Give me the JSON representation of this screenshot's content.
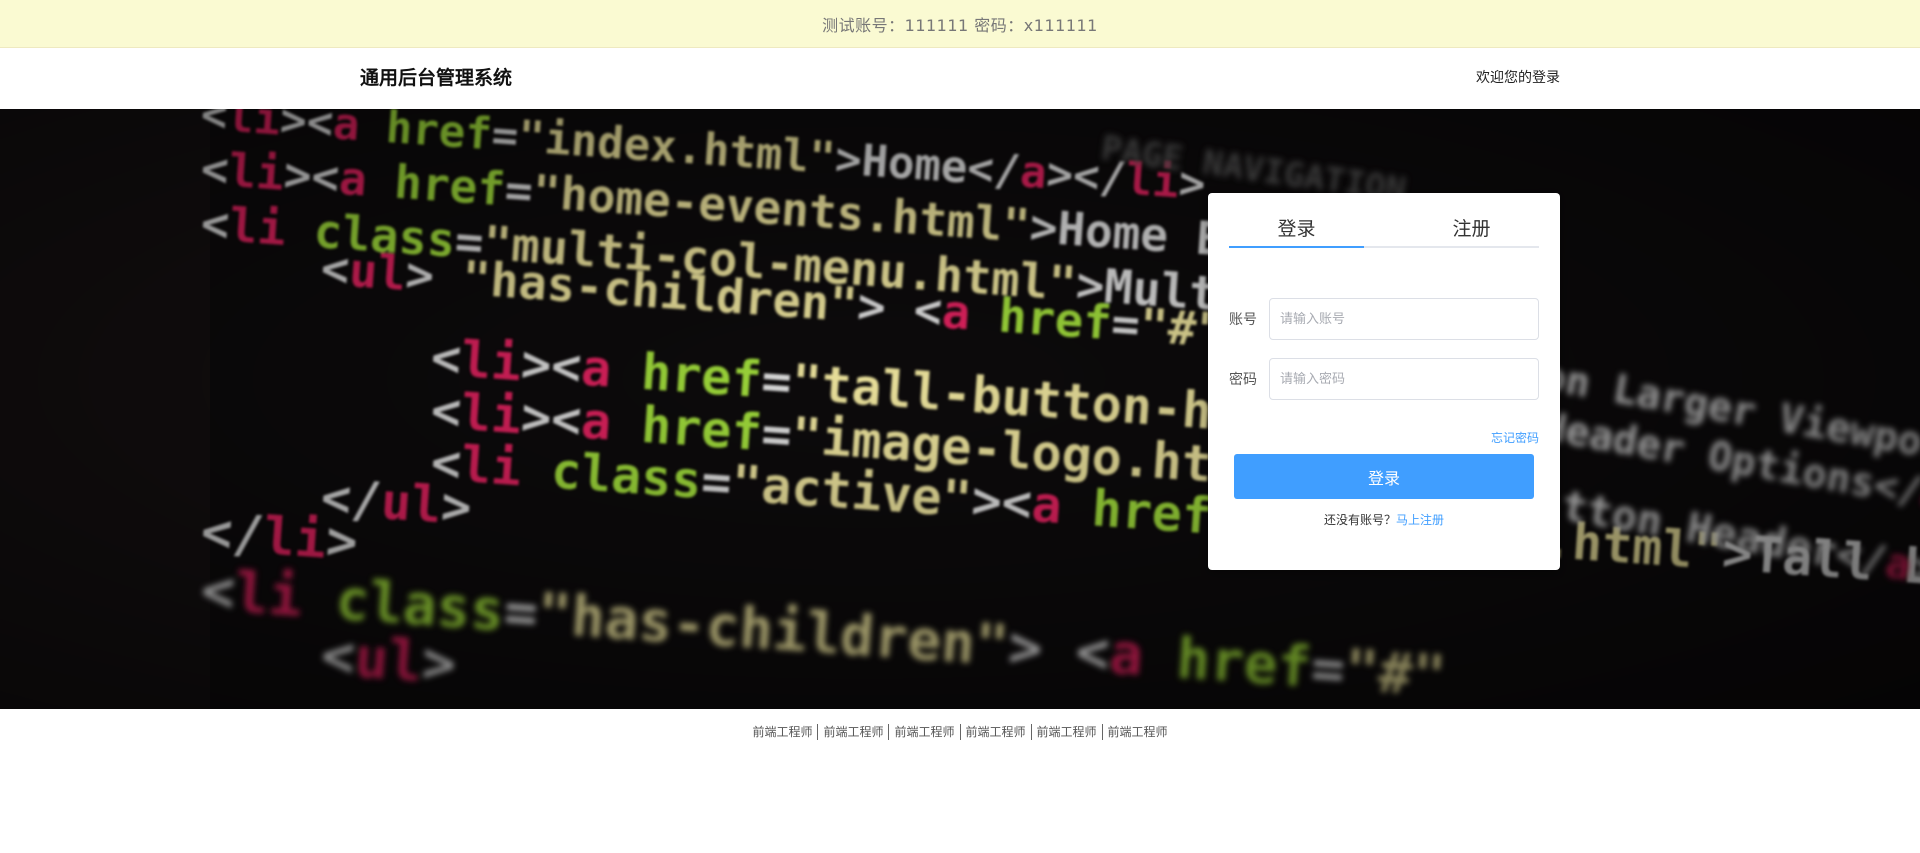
{
  "notice": {
    "text": "测试账号：111111 密码：x111111"
  },
  "header": {
    "title": "通用后台管理系统",
    "welcome": "欢迎您的登录"
  },
  "hero": {
    "code_lines": [
      [
        "<li><a href=\"index.html\">Home</a></li>"
      ],
      [
        "<li><a href=\"home-events.html\">Home Events</a></li>"
      ],
      [
        "<li class=\"has-children\"><a href=\"#\">Multi</a>"
      ]
    ]
  },
  "login_card": {
    "tabs": [
      "登录",
      "注册"
    ],
    "account_label": "账号",
    "account_placeholder": "请输入账号",
    "password_label": "密码",
    "password_placeholder": "请输入密码",
    "forgot_label": "忘记密码",
    "submit_label": "登录",
    "signup_prompt": "还没有账号？",
    "signup_link": "马上注册"
  },
  "footer": {
    "links": [
      "前端工程师",
      "前端工程师",
      "前端工程师",
      "前端工程师",
      "前端工程师",
      "前端工程师"
    ]
  },
  "colors": {
    "accent": "#409eff",
    "notice_bg": "#fafad2",
    "hero_bg": "#0c0a0b"
  }
}
